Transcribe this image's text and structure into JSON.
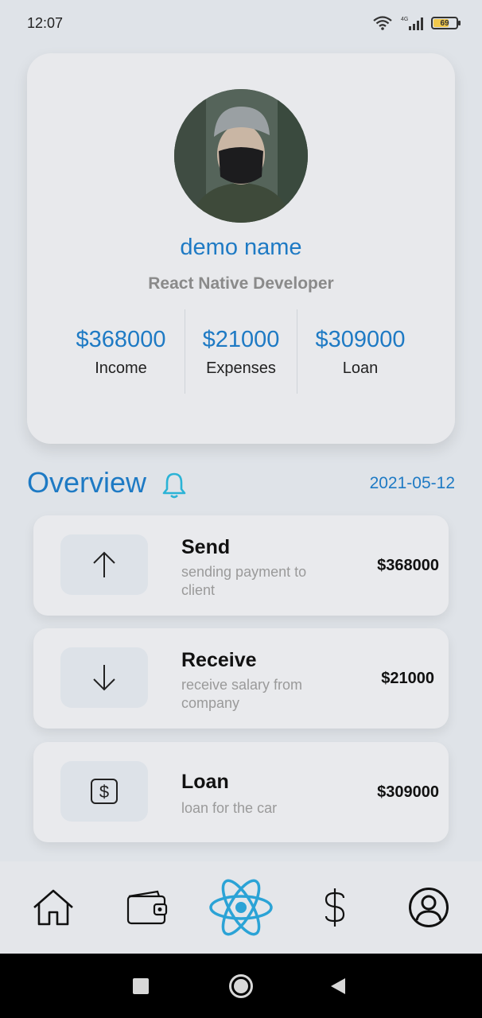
{
  "status_bar": {
    "time": "12:07",
    "network": "4G",
    "battery": "69",
    "battery_level": 0.69
  },
  "profile": {
    "name": "demo name",
    "role": "React Native Developer",
    "stats": [
      {
        "value": "$368000",
        "label": "Income"
      },
      {
        "value": "$21000",
        "label": "Expenses"
      },
      {
        "value": "$309000",
        "label": "Loan"
      }
    ]
  },
  "overview": {
    "title": "Overview",
    "date": "2021-05-12"
  },
  "transactions": [
    {
      "title": "Send",
      "description": "sending payment to client",
      "amount": "$368000",
      "icon": "arrow-up-icon"
    },
    {
      "title": "Receive",
      "description": "receive salary from company",
      "amount": "$21000",
      "icon": "arrow-down-icon"
    },
    {
      "title": "Loan",
      "description": "loan for the car",
      "amount": "$309000",
      "icon": "dollar-box-icon"
    }
  ],
  "bottom_nav": {
    "items": [
      "home-icon",
      "wallet-icon",
      "react-atom-icon",
      "dollar-icon",
      "profile-icon"
    ],
    "active": "react-atom-icon"
  },
  "colors": {
    "accent": "#1e7ac4",
    "active_nav": "#2ba3d6",
    "background": "#dfe3e8",
    "card": "#e8e9ec"
  }
}
